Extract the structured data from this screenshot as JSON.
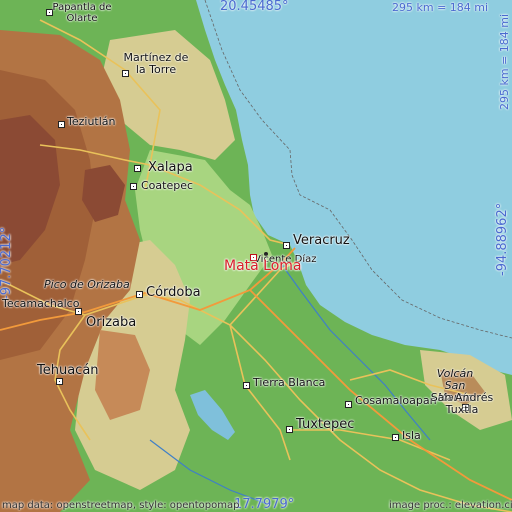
{
  "colors": {
    "sea": "#8fcde0",
    "lowland": "#5fae4b",
    "plain": "#9bcf78",
    "hills": "#cfc98d",
    "mountain": "#b27444",
    "peak": "#8b4a34",
    "main_marker": "#d81e2a",
    "coordinate_text": "#4a6ad0",
    "road": "#e9c25a"
  },
  "coordinates": {
    "north": "20.45485°",
    "south": "17.7979°",
    "west": "-97.70212°",
    "east": "-94.88962°",
    "scale_top": "295 km = 184 mi",
    "scale_right": "295 km = 184 mi"
  },
  "main_place": "Mata Loma",
  "places": [
    {
      "id": "papantla",
      "name": "Papantla de Olarte"
    },
    {
      "id": "martinez",
      "name": "Martínez de la Torre"
    },
    {
      "id": "teziutlan",
      "name": "Teziutlán"
    },
    {
      "id": "xalapa",
      "name": "Xalapa"
    },
    {
      "id": "coatepec",
      "name": "Coatepec"
    },
    {
      "id": "veracruz",
      "name": "Veracruz"
    },
    {
      "id": "vicente",
      "name": "Vicente Díaz"
    },
    {
      "id": "pico",
      "name": "Pico de Orizaba"
    },
    {
      "id": "tecamachalco",
      "name": "Tecamachalco"
    },
    {
      "id": "cordoba",
      "name": "Córdoba"
    },
    {
      "id": "orizaba",
      "name": "Orizaba"
    },
    {
      "id": "tehuacan",
      "name": "Tehuacán"
    },
    {
      "id": "tierra",
      "name": "Tierra Blanca"
    },
    {
      "id": "cosamaloapan",
      "name": "Cosamaloapan"
    },
    {
      "id": "tuxtepec",
      "name": "Tuxtepec"
    },
    {
      "id": "isla",
      "name": "Isla"
    },
    {
      "id": "sanmartin",
      "name": "Volcán San Martín"
    },
    {
      "id": "sanandres",
      "name": "San Andrés Tuxtla"
    }
  ],
  "credits": {
    "left": "map data: openstreetmap, style: opentopomap",
    "right": "image proc.: elevation.city"
  }
}
